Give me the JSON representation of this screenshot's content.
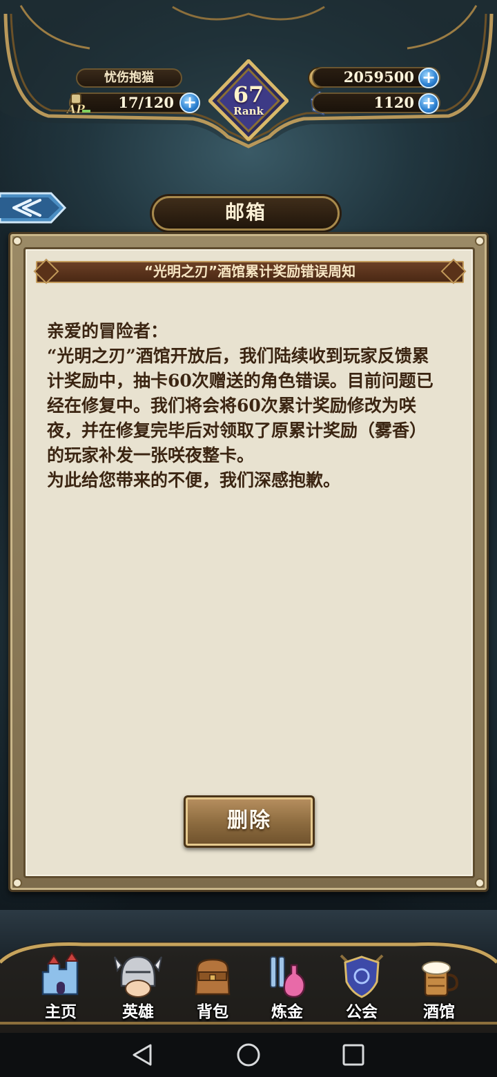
{
  "hud": {
    "player_name": "忧伤抱猫",
    "ap_label": "AP",
    "ap_value": "17/120",
    "gold_value": "2059500",
    "gem_value": "1120",
    "rank_number": "67",
    "rank_label": "Rank"
  },
  "screen": {
    "title": "邮箱"
  },
  "mail": {
    "subject": "“光明之刃”酒馆累计奖励错误周知",
    "body_lines": [
      "亲爱的冒险者：",
      "“光明之刃”酒馆开放后，我们陆续收到玩家反馈累计奖励中，抽卡60次赠送的角色错误。目前问题已经在修复中。我们将会将60次累计奖励修改为咲夜，并在修复完毕后对领取了原累计奖励（雾香）的玩家补发一张咲夜整卡。",
      "为此给您带来的不便，我们深感抱歉。"
    ],
    "delete_label": "删除"
  },
  "nav": {
    "items": [
      {
        "label": "主页",
        "icon": "castle-icon"
      },
      {
        "label": "英雄",
        "icon": "helmet-icon"
      },
      {
        "label": "背包",
        "icon": "backpack-icon"
      },
      {
        "label": "炼金",
        "icon": "potion-icon"
      },
      {
        "label": "公会",
        "icon": "guild-shield-icon"
      },
      {
        "label": "酒馆",
        "icon": "beer-mug-icon"
      }
    ]
  },
  "colors": {
    "panel_parchment": "#e8e2d0",
    "subject_bar": "#4a2814",
    "body_text": "#3b2512",
    "plus_blue": "#2a7fd0",
    "gold_trim": "#a88a4c"
  }
}
